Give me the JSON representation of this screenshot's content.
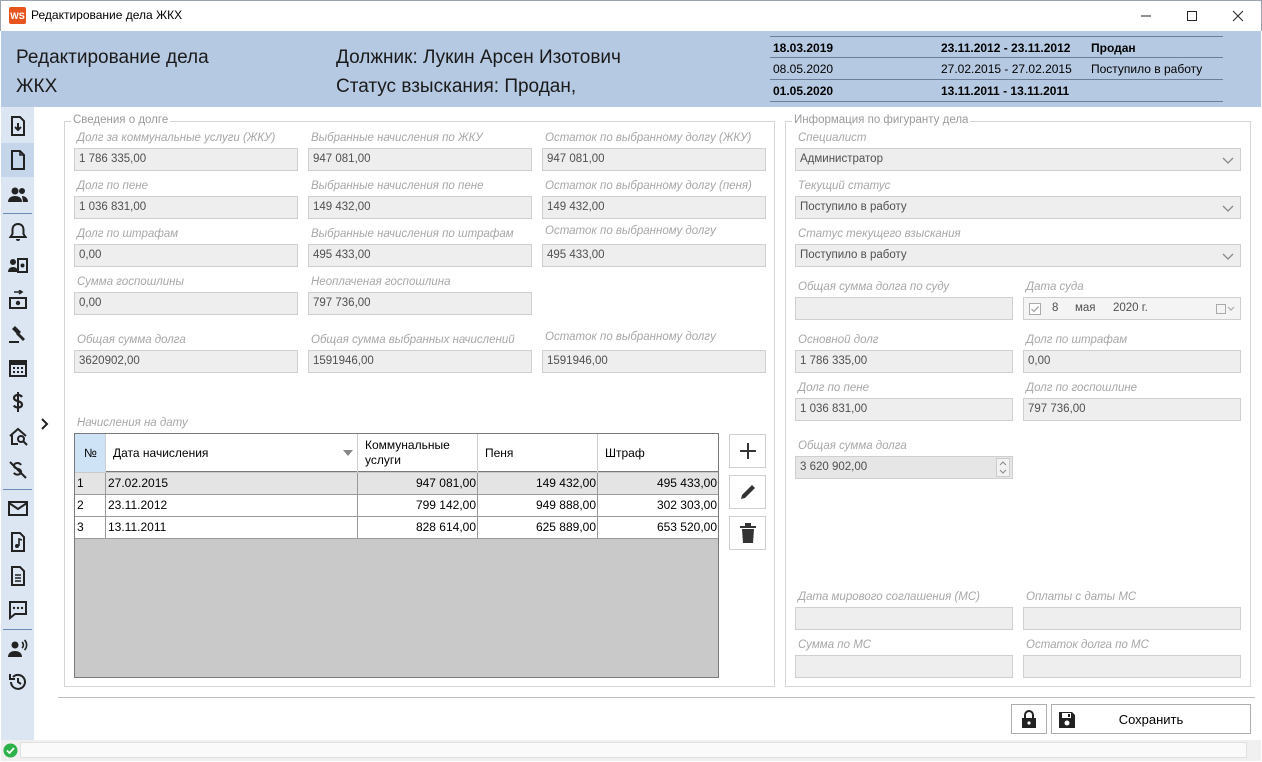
{
  "window": {
    "title": "Редактирование дела ЖКХ",
    "app_badge": "WS"
  },
  "header": {
    "title_line1": "Редактирование дела",
    "title_line2": "ЖКХ",
    "debtor": "Должник: Лукин Арсен Изотович",
    "status": "Статус взыскания: Продан,",
    "history": [
      {
        "date": "18.03.2019",
        "period": "23.11.2012 - 23.11.2012",
        "status": "Продан",
        "bold": true
      },
      {
        "date": "08.05.2020",
        "period": "27.02.2015 - 27.02.2015",
        "status": "Поступило в работу",
        "bold": false
      },
      {
        "date": "01.05.2020",
        "period": "13.11.2011 - 13.11.2011",
        "status": "",
        "bold": true
      }
    ]
  },
  "sidebar": {
    "icons": [
      "download-doc-icon",
      "document-icon",
      "users-icon",
      "bell-icon",
      "id-card-icon",
      "money-transfer-icon",
      "gavel-icon",
      "calendar-icon",
      "dollar-icon",
      "house-search-icon",
      "no-money-icon",
      "mail-icon",
      "music-file-icon",
      "text-file-icon",
      "chat-icon",
      "speaker-user-icon",
      "history-icon"
    ],
    "selected_index": 1
  },
  "debt": {
    "legend": "Сведения о долге",
    "fields": [
      {
        "label": "Долг за коммунальные услуги (ЖКУ)",
        "value": "1 786 335,00"
      },
      {
        "label": "Выбранные начисления по ЖКУ",
        "value": "947 081,00"
      },
      {
        "label": "Остаток по выбранному долгу (ЖКУ)",
        "value": "947 081,00"
      },
      {
        "label": "Долг по пене",
        "value": "1 036 831,00"
      },
      {
        "label": "Выбранные начисления по пене",
        "value": "149 432,00"
      },
      {
        "label": "Остаток по выбранному долгу (пеня)",
        "value": "149 432,00"
      },
      {
        "label": "Долг по штрафам",
        "value": "0,00"
      },
      {
        "label": "Выбранные начисления по штрафам",
        "value": "495 433,00"
      },
      {
        "label": "Остаток по выбранному долгу",
        "value": "495 433,00"
      },
      {
        "label": "Сумма госпошлины",
        "value": "0,00"
      },
      {
        "label": "Неоплаченая госпошлина",
        "value": "797 736,00"
      },
      {
        "label": "Общая сумма долга",
        "value": "3620902,00"
      },
      {
        "label": "Общая сумма выбранных начислений",
        "value": "1591946,00"
      },
      {
        "label": "Остаток по выбранному долгу",
        "value": "1591946,00"
      }
    ]
  },
  "charges": {
    "legend": "Начисления на дату",
    "columns": [
      "№",
      "Дата начисления",
      "Коммунальные услуги",
      "Пеня",
      "Штраф"
    ],
    "rows": [
      {
        "num": "1",
        "date": "27.02.2015",
        "utilities": "947 081,00",
        "penalty": "149 432,00",
        "fine": "495 433,00"
      },
      {
        "num": "2",
        "date": "23.11.2012",
        "utilities": "799 142,00",
        "penalty": "949 888,00",
        "fine": "302 303,00"
      },
      {
        "num": "3",
        "date": "13.11.2011",
        "utilities": "828 614,00",
        "penalty": "625 889,00",
        "fine": "653 520,00"
      }
    ],
    "selected_row": 0
  },
  "info": {
    "legend": "Информация по фигуранту дела",
    "specialist": {
      "label": "Специалист",
      "value": "Администратор"
    },
    "current_status": {
      "label": "Текущий статус",
      "value": "Поступило в работу"
    },
    "collection_status": {
      "label": "Статус текущего взыскания",
      "value": "Поступило в работу"
    },
    "court_total": {
      "label": "Общая сумма долга по суду",
      "value": ""
    },
    "court_date": {
      "label": "Дата суда",
      "day": "8",
      "month": "мая",
      "year": "2020 г."
    },
    "main_debt": {
      "label": "Основной долг",
      "value": "1 786 335,00"
    },
    "fine_debt": {
      "label": "Долг по штрафам",
      "value": "0,00"
    },
    "penalty_debt": {
      "label": "Долг по пене",
      "value": "1 036 831,00"
    },
    "duty_debt": {
      "label": "Долг по госпошлине",
      "value": "797 736,00"
    },
    "total_debt": {
      "label": "Общая сумма долга",
      "value": "3 620 902,00"
    },
    "settlement_date": {
      "label": "Дата мирового соглашения (МС)",
      "value": ""
    },
    "payments_since": {
      "label": "Оплаты с даты МС",
      "value": ""
    },
    "settlement_sum": {
      "label": "Сумма по МС",
      "value": ""
    },
    "settlement_rest": {
      "label": "Остаток долга по МС",
      "value": ""
    }
  },
  "footer": {
    "save_label": "Сохранить"
  }
}
